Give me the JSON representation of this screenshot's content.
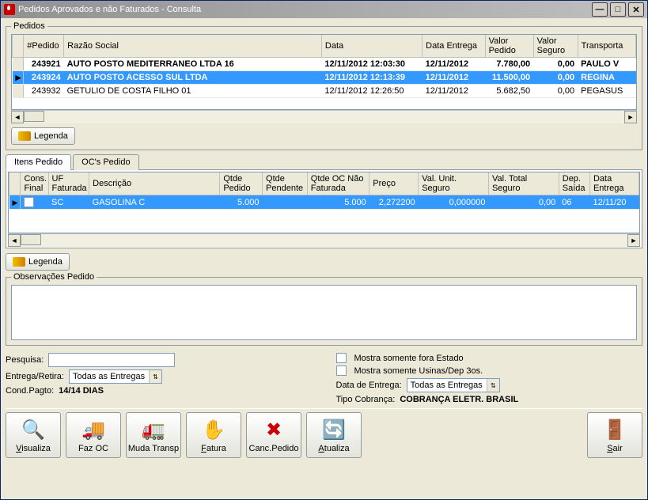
{
  "window": {
    "title": "Pedidos Aprovados e não Faturados - Consulta"
  },
  "pedidos": {
    "legend": "Pedidos",
    "headers": {
      "num": "#Pedido",
      "razao": "Razão Social",
      "data": "Data",
      "entrega": "Data Entrega",
      "valorPedido": "Valor Pedido",
      "valorSeguro": "Valor Seguro",
      "transp": "Transporta"
    },
    "rows": [
      {
        "num": "243921",
        "razao": "AUTO POSTO MEDITERRANEO LTDA 16",
        "data": "12/11/2012 12:03:30",
        "entrega": "12/11/2012",
        "valorPedido": "7.780,00",
        "valorSeguro": "0,00",
        "transp": "PAULO V",
        "bold": true
      },
      {
        "num": "243924",
        "razao": "AUTO POSTO ACESSO SUL LTDA",
        "data": "12/11/2012 12:13:39",
        "entrega": "12/11/2012",
        "valorPedido": "11.500,00",
        "valorSeguro": "0,00",
        "transp": "REGINA",
        "bold": true,
        "sel": true
      },
      {
        "num": "243932",
        "razao": "GETULIO DE COSTA FILHO 01",
        "data": "12/11/2012 12:26:50",
        "entrega": "12/11/2012",
        "valorPedido": "5.682,50",
        "valorSeguro": "0,00",
        "transp": "PEGASUS"
      }
    ]
  },
  "legenda": "Legenda",
  "tabs": {
    "itens": "Itens Pedido",
    "ocs": "OC's Pedido"
  },
  "itens": {
    "headers": {
      "consFinal": "Cons. Final",
      "uf": "UF Faturada",
      "desc": "Descrição",
      "qtdePedido": "Qtde Pedido",
      "qtdePend": "Qtde Pendente",
      "qtdeOC": "Qtde OC Não Faturada",
      "preco": "Preço",
      "valUnitSeg": "Val. Unit. Seguro",
      "valTotSeg": "Val. Total Seguro",
      "depSaida": "Dep. Saída",
      "dataEntrega": "Data Entrega"
    },
    "rows": [
      {
        "uf": "SC",
        "desc": "GASOLINA C",
        "qtdePedido": "5.000",
        "qtdePend": "",
        "qtdeOC": "5.000",
        "preco": "2,272200",
        "valUnitSeg": "0,000000",
        "valTotSeg": "0,00",
        "depSaida": "06",
        "dataEntrega": "12/11/20",
        "sel": true
      }
    ]
  },
  "obs": {
    "legend": "Observações Pedido"
  },
  "filters": {
    "pesquisaLabel": "Pesquisa:",
    "entregaRetiraLabel": "Entrega/Retira:",
    "entregaRetiraValue": "Todas as Entregas",
    "condPagtoLabel": "Cond.Pagto:",
    "condPagtoValue": "14/14 DIAS",
    "foraEstado": "Mostra somente fora Estado",
    "usinasDep": "Mostra somente Usinas/Dep 3os.",
    "dataEntregaLabel": "Data de Entrega:",
    "dataEntregaValue": "Todas as Entregas",
    "tipoCobrancaLabel": "Tipo Cobrança:",
    "tipoCobrancaValue": "COBRANÇA ELETR. BRASIL"
  },
  "buttons": {
    "visualiza": "Visualiza",
    "fazOC": "Faz OC",
    "mudaTransp": "Muda Transp",
    "fatura": "Fatura",
    "cancPedido": "Canc.Pedido",
    "atualiza": "Atualiza",
    "sair": "Sair"
  }
}
